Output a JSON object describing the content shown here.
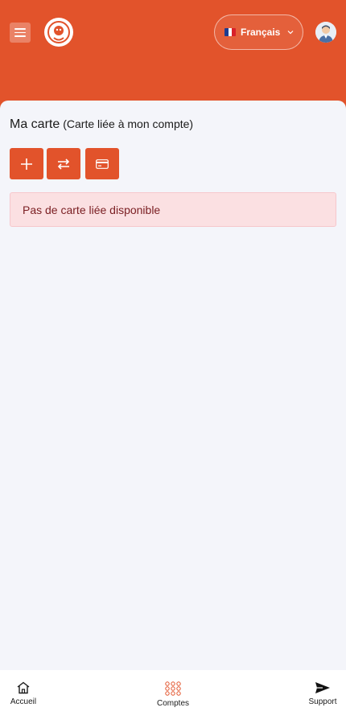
{
  "header": {
    "language": {
      "label": "Français",
      "flag_colors": [
        "#1f3c8f",
        "#ffffff",
        "#d8202a"
      ]
    }
  },
  "card": {
    "title": "Ma carte",
    "subtitle": "(Carte liée à mon compte)",
    "actions": [
      {
        "icon": "plus-icon"
      },
      {
        "icon": "transfer-arrows-icon"
      },
      {
        "icon": "credit-card-icon"
      }
    ],
    "empty_message": "Pas de carte liée disponible"
  },
  "bottom_nav": {
    "items": [
      {
        "label": "Accueil",
        "icon": "home-icon"
      },
      {
        "label": "Comptes",
        "icon": "grid-icon"
      },
      {
        "label": "Support",
        "icon": "send-icon"
      }
    ]
  },
  "colors": {
    "brand": "#e2532b",
    "background": "#f4f5fa",
    "alert_bg": "#fbe0e2",
    "alert_text": "#7a1e22"
  }
}
